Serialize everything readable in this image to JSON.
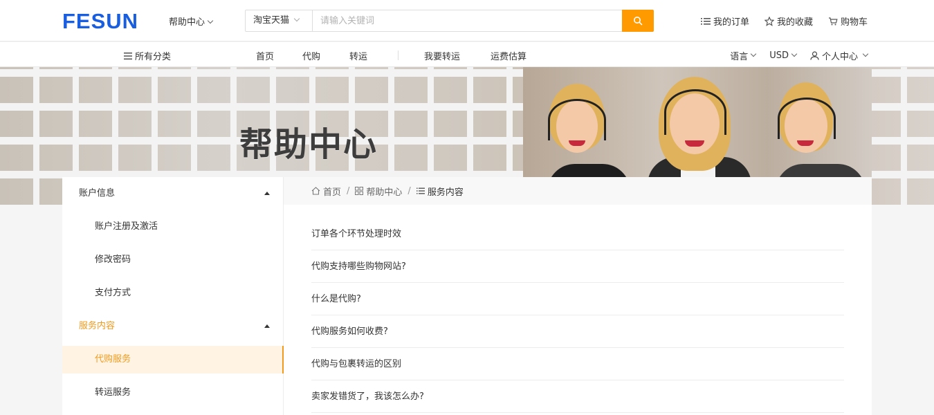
{
  "header": {
    "logo": "FESUN",
    "help_center": "帮助中心",
    "search": {
      "scope": "淘宝天猫",
      "placeholder": "请输入关键词"
    },
    "links": {
      "orders": "我的订单",
      "favorites": "我的收藏",
      "cart": "购物车"
    }
  },
  "nav": {
    "all_categories": "所有分类",
    "items": [
      "首页",
      "代购",
      "转运",
      "我要转运",
      "运费估算"
    ],
    "language": "语言",
    "currency": "USD",
    "account": "个人中心"
  },
  "banner": {
    "title": "帮助中心"
  },
  "sidebar": {
    "groups": [
      {
        "label": "账户信息",
        "items": [
          "账户注册及激活",
          "修改密码",
          "支付方式"
        ]
      },
      {
        "label": "服务内容",
        "items": [
          "代购服务",
          "转运服务"
        ]
      }
    ]
  },
  "breadcrumb": {
    "home": "首页",
    "help": "帮助中心",
    "current": "服务内容"
  },
  "faq": [
    "订单各个环节处理时效",
    "代购支持哪些购物网站?",
    "什么是代购?",
    "代购服务如何收费?",
    "代购与包裹转运的区别",
    "卖家发错货了，我该怎么办?"
  ],
  "colors": {
    "brand": "#1a5ee0",
    "accent": "#ff9a00",
    "active": "#f29a1f"
  }
}
